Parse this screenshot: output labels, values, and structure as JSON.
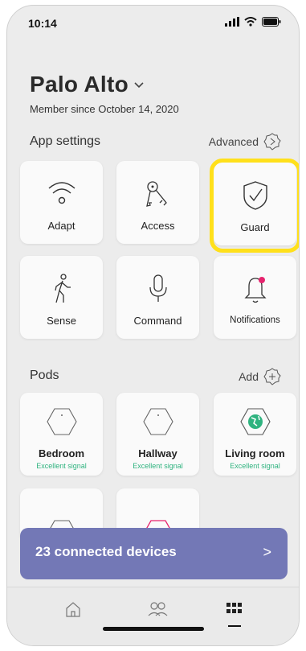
{
  "status_bar": {
    "time": "10:14"
  },
  "header": {
    "location": "Palo Alto",
    "member_since": "Member since October 14, 2020"
  },
  "app_settings": {
    "heading": "App settings",
    "advanced_label": "Advanced",
    "tiles": [
      {
        "label": "Adapt",
        "icon": "wifi-icon"
      },
      {
        "label": "Access",
        "icon": "keys-icon"
      },
      {
        "label": "Guard",
        "icon": "shield-check-icon"
      },
      {
        "label": "Sense",
        "icon": "walking-person-icon"
      },
      {
        "label": "Command",
        "icon": "microphone-icon"
      },
      {
        "label": "Notifications",
        "icon": "bell-icon"
      }
    ]
  },
  "pods": {
    "heading": "Pods",
    "add_label": "Add",
    "items": [
      {
        "name": "Bedroom",
        "signal": "Excellent signal"
      },
      {
        "name": "Hallway",
        "signal": "Excellent signal"
      },
      {
        "name": "Living room",
        "signal": "Excellent signal"
      }
    ]
  },
  "devices_bar": {
    "label": "23 connected devices",
    "chevron": ">"
  },
  "tabbar": {
    "tabs": [
      "home-icon",
      "people-icon",
      "grid-icon"
    ],
    "active": "grid-icon"
  },
  "colors": {
    "highlight": "#ffe01b",
    "devices_bar": "#7378b6",
    "signal_green": "#2fb37f",
    "notification_dot": "#e6246e"
  }
}
